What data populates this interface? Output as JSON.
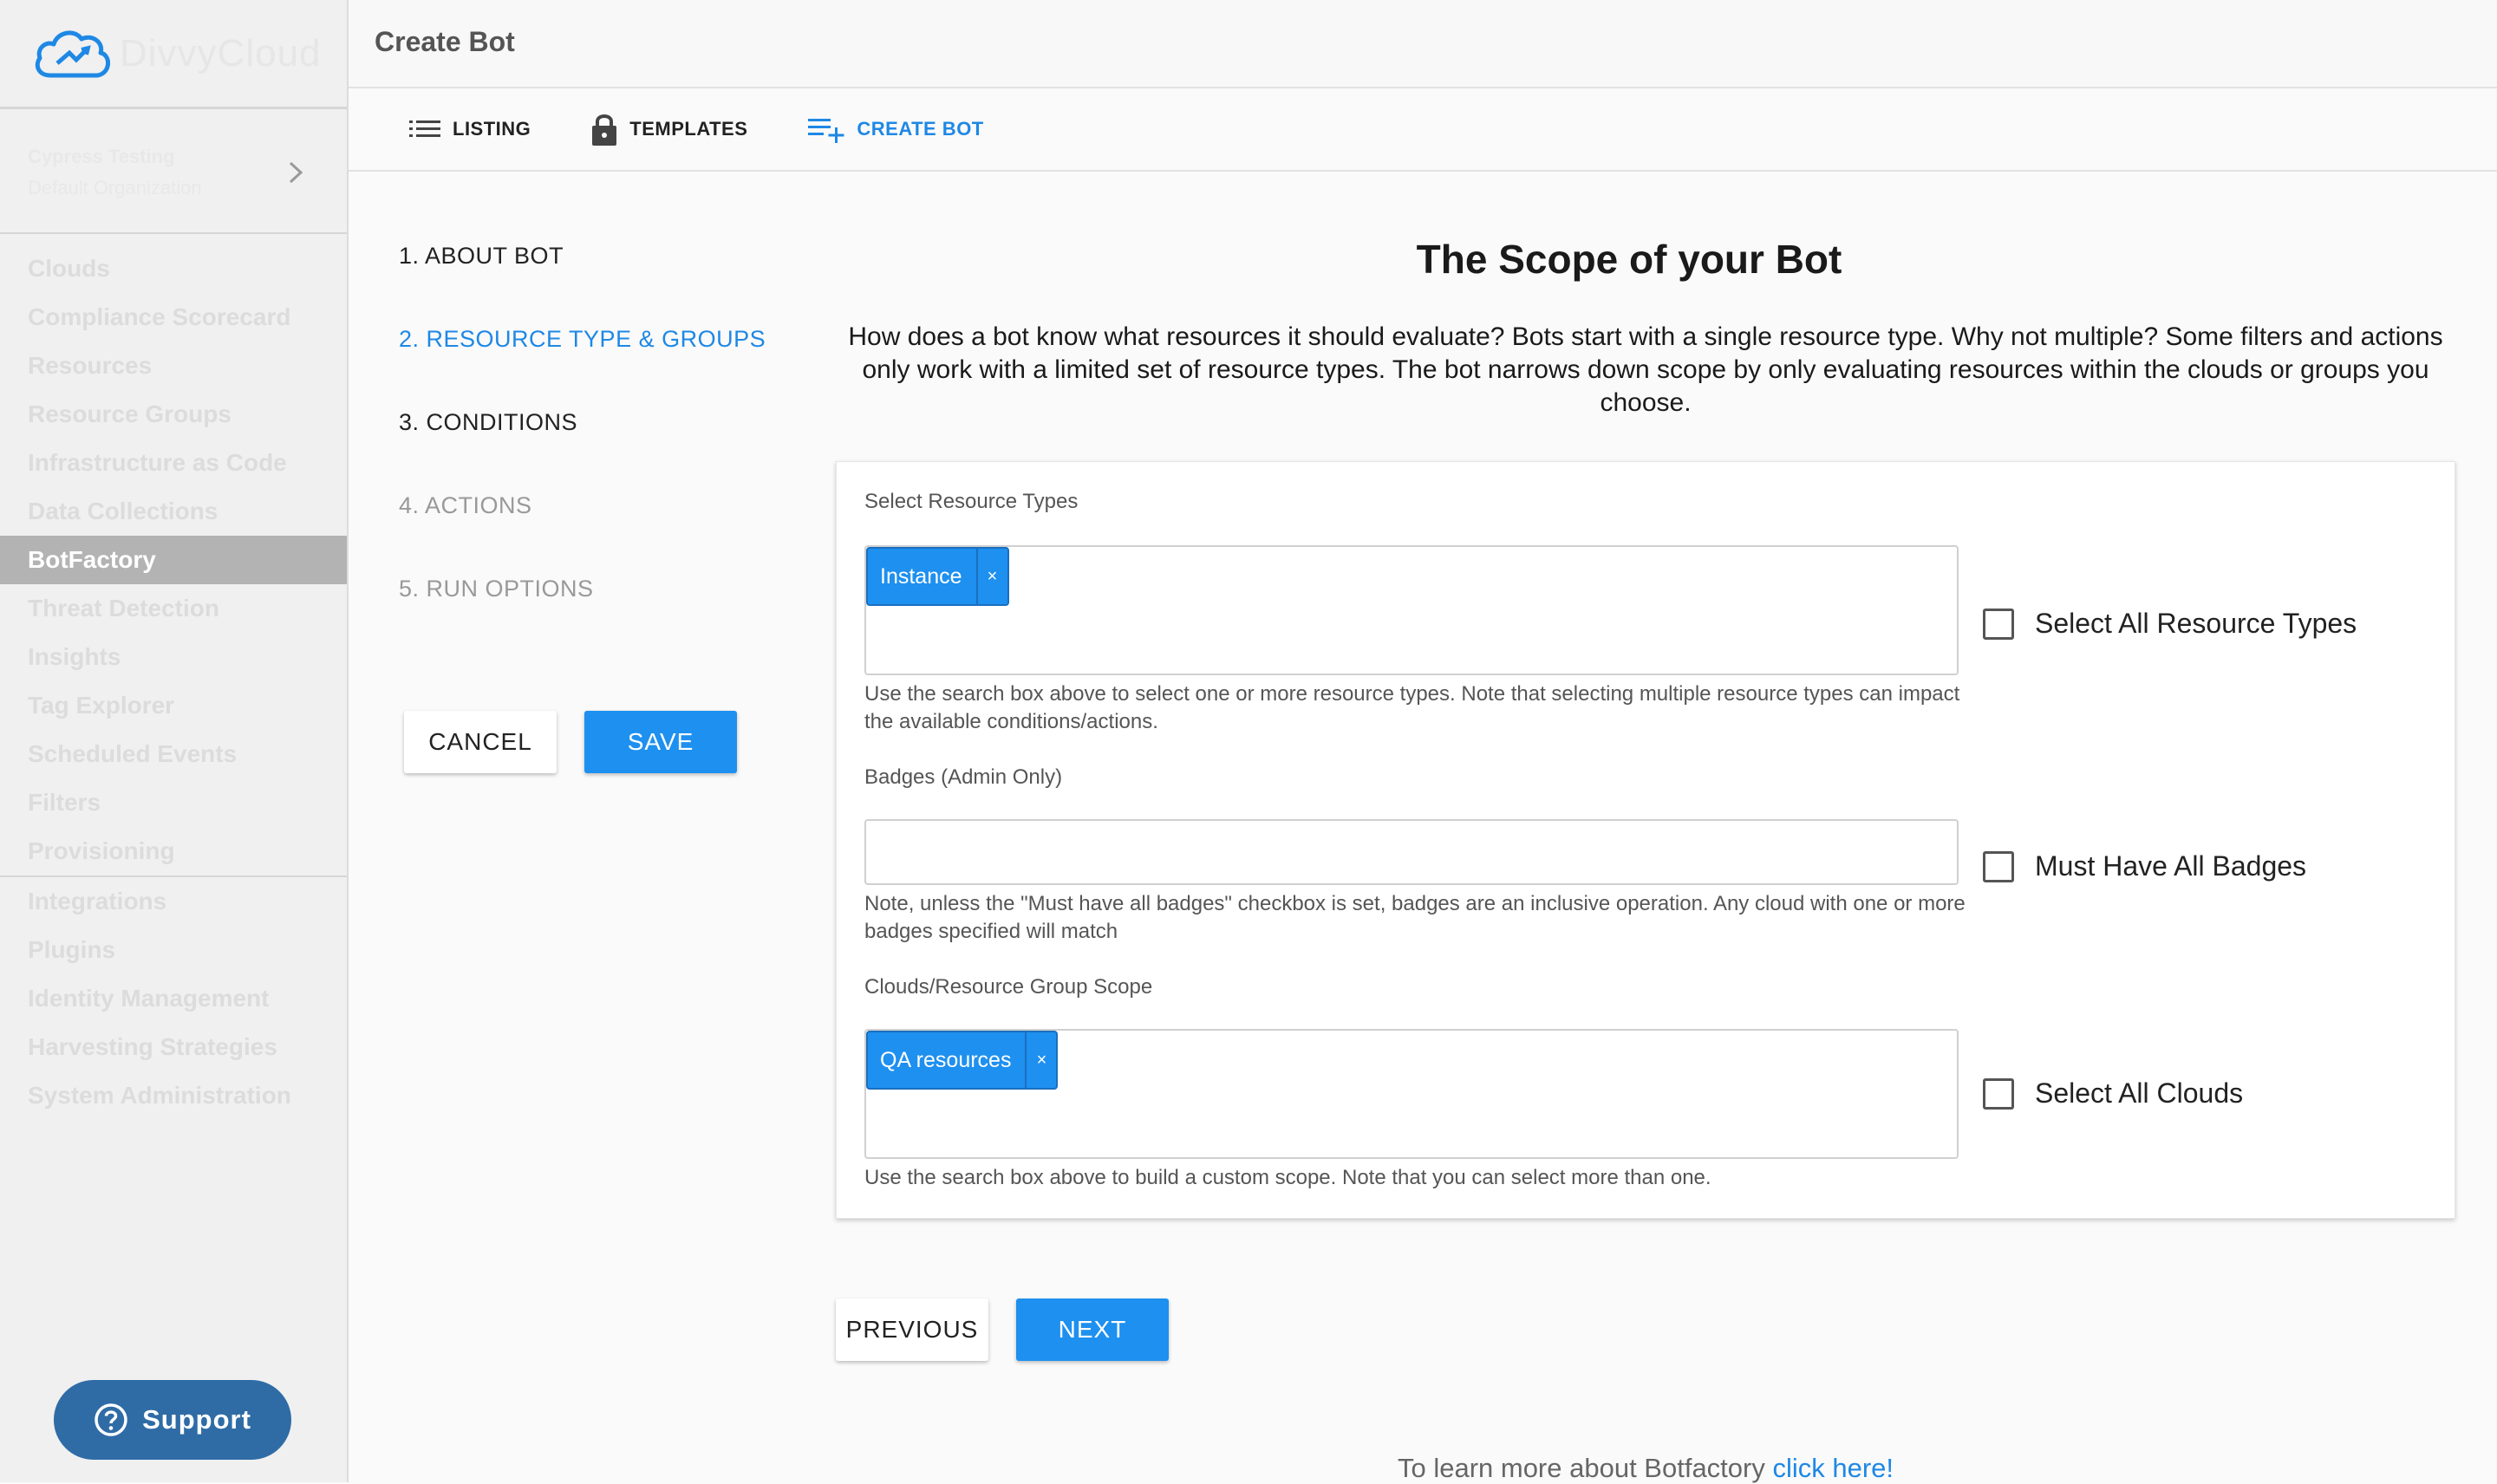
{
  "sidebar": {
    "brand": "DivvyCloud",
    "org_name": "Cypress Testing",
    "org_sub": "Default Organization",
    "items": [
      {
        "label": "Clouds"
      },
      {
        "label": "Compliance Scorecard"
      },
      {
        "label": "Resources"
      },
      {
        "label": "Resource Groups"
      },
      {
        "label": "Infrastructure as Code"
      },
      {
        "label": "Data Collections"
      },
      {
        "label": "BotFactory"
      },
      {
        "label": "Threat Detection"
      },
      {
        "label": "Insights"
      },
      {
        "label": "Tag Explorer"
      },
      {
        "label": "Scheduled Events"
      },
      {
        "label": "Filters"
      },
      {
        "label": "Provisioning"
      },
      {
        "label": "Integrations"
      },
      {
        "label": "Plugins"
      },
      {
        "label": "Identity Management"
      },
      {
        "label": "Harvesting Strategies"
      },
      {
        "label": "System Administration"
      }
    ],
    "active_item": "BotFactory",
    "support_label": "Support"
  },
  "header": {
    "title": "Create Bot"
  },
  "tabs": [
    {
      "label": "LISTING",
      "icon": "list-icon"
    },
    {
      "label": "TEMPLATES",
      "icon": "lock-icon"
    },
    {
      "label": "CREATE BOT",
      "icon": "add-list-icon",
      "active": true
    }
  ],
  "steps": [
    {
      "label": "1. ABOUT BOT",
      "state": "normal"
    },
    {
      "label": "2. RESOURCE TYPE & GROUPS",
      "state": "active"
    },
    {
      "label": "3. CONDITIONS",
      "state": "normal"
    },
    {
      "label": "4. ACTIONS",
      "state": "disabled"
    },
    {
      "label": "5. RUN OPTIONS",
      "state": "disabled"
    }
  ],
  "actions": {
    "cancel": "CANCEL",
    "save": "SAVE"
  },
  "main": {
    "title": "The Scope of your Bot",
    "description": "How does a bot know what resources it should evaluate? Bots start with a single resource type. Why not multiple? Some filters and actions only work with a limited set of resource types. The bot narrows down scope by only evaluating resources within the clouds or groups you choose.",
    "resource_types": {
      "label": "Select Resource Types",
      "chips": [
        "Instance"
      ],
      "help": "Use the search box above to select one or more resource types. Note that selecting multiple resource types can impact the available conditions/actions.",
      "checkbox_label": "Select All Resource Types",
      "checked": false
    },
    "badges": {
      "label": "Badges (Admin Only)",
      "value": "",
      "help": "Note, unless the \"Must have all badges\" checkbox is set, badges are an inclusive operation. Any cloud with one or more badges specified will match",
      "checkbox_label": "Must Have All Badges",
      "checked": false
    },
    "scope": {
      "label": "Clouds/Resource Group Scope",
      "chips": [
        "QA resources"
      ],
      "help": "Use the search box above to build a custom scope. Note that you can select more than one.",
      "checkbox_label": "Select All Clouds",
      "checked": false
    },
    "chip_remove": "×",
    "previous": "PREVIOUS",
    "next": "NEXT",
    "learn_more_text": "To learn more about Botfactory ",
    "learn_more_link": "click here!"
  },
  "colors": {
    "accent": "#1e88e5",
    "chip": "#1e90f0",
    "support": "#2f6ca6"
  }
}
